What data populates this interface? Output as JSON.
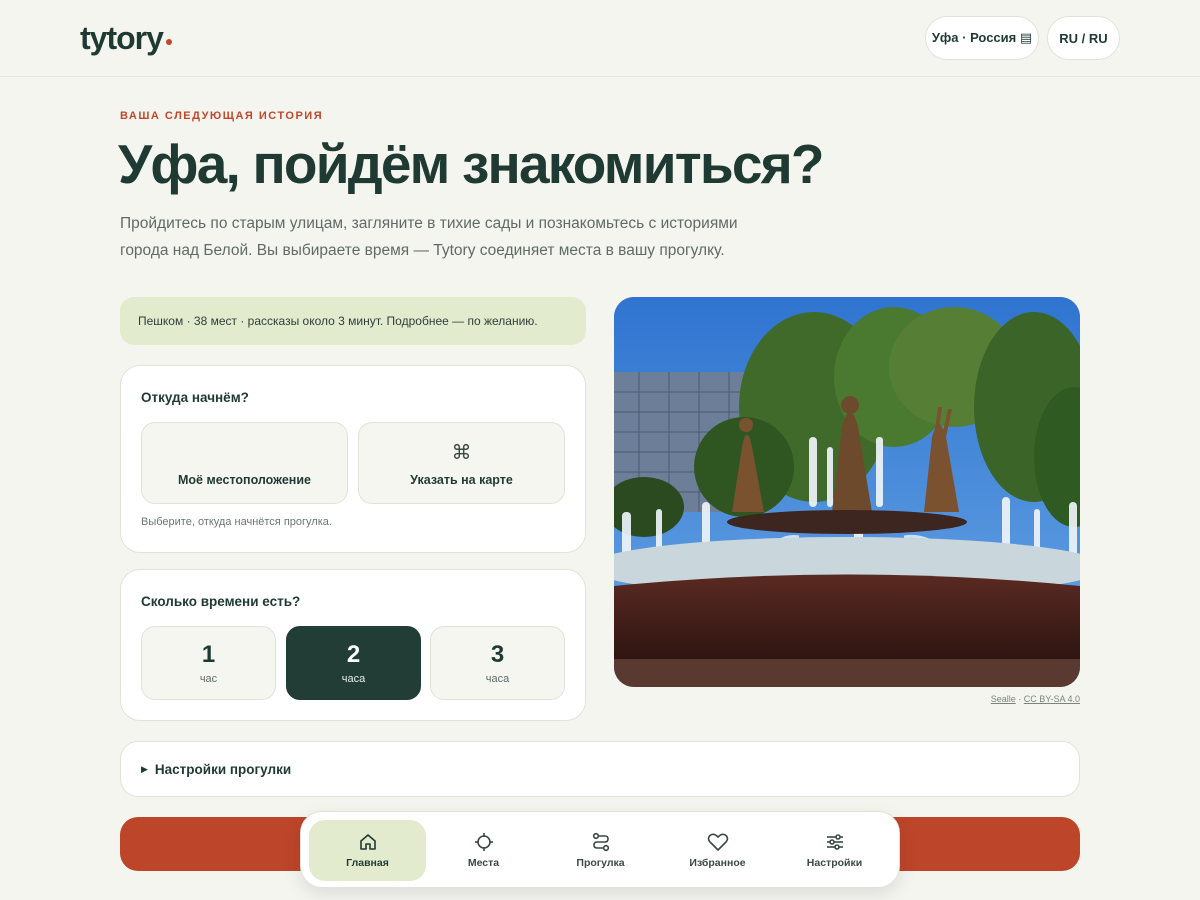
{
  "header": {
    "logo": "tytory",
    "city_pill": "Уфа · Россия ▤",
    "lang_pill": "RU / RU"
  },
  "hero": {
    "eyebrow": "ВАША СЛЕДУЮЩАЯ ИСТОРИЯ",
    "title": "Уфа, пойдём знакомиться?",
    "lead": "Пройдитесь по старым улицам, загляните в тихие сады и познакомьтесь с историями города над Белой. Вы выбираете время — Tytory соединяет места в вашу прогулку."
  },
  "info_banner": "Пешком · 38 мест · рассказы около 3 минут. Подробнее — по желанию.",
  "start_card": {
    "heading": "Откуда начнём?",
    "option_location": "Моё местоположение",
    "option_map": "Указать на карте",
    "option_map_icon": "⌘",
    "hint": "Выберите, откуда начнётся прогулка."
  },
  "time_card": {
    "heading": "Сколько времени есть?",
    "options": [
      {
        "num": "1",
        "unit": "час"
      },
      {
        "num": "2",
        "unit": "часа",
        "selected": true
      },
      {
        "num": "3",
        "unit": "часа"
      }
    ]
  },
  "photo": {
    "credit_author": "Sealle",
    "credit_sep": " · ",
    "credit_license": "CC BY-SA 4.0"
  },
  "settings": {
    "label": "Настройки прогулки"
  },
  "tabbar": {
    "items": [
      {
        "label": "Главная",
        "icon": "home-icon",
        "active": true
      },
      {
        "label": "Места",
        "icon": "crosshair-icon"
      },
      {
        "label": "Прогулка",
        "icon": "route-icon"
      },
      {
        "label": "Избранное",
        "icon": "heart-icon"
      },
      {
        "label": "Настройки",
        "icon": "sliders-icon"
      }
    ]
  },
  "colors": {
    "accent": "#c0472a",
    "primary": "#1f3a33",
    "banner": "#e3ebcf",
    "cta": "#bd4529",
    "background": "#f5f5f0"
  }
}
